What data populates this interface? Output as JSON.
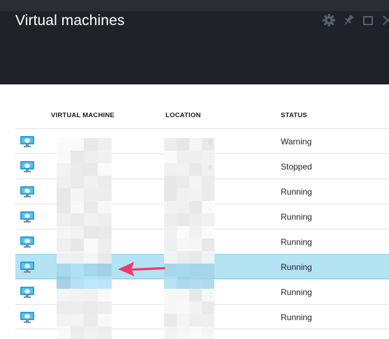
{
  "blade": {
    "title": "Virtual machines",
    "actions": [
      {
        "icon": "gear-icon"
      },
      {
        "icon": "pin-icon"
      },
      {
        "icon": "maximize-icon"
      },
      {
        "icon": "close-icon"
      }
    ]
  },
  "grid": {
    "columns": [
      "VIRTUAL MACHINE",
      "LOCATION",
      "STATUS"
    ],
    "rows": [
      {
        "icon": "virtual-machine-icon",
        "location_tail": "e",
        "status": "Warning",
        "selected": false
      },
      {
        "icon": "virtual-machine-icon",
        "location_tail": "e",
        "status": "Stopped",
        "selected": false
      },
      {
        "icon": "virtual-machine-icon",
        "location_tail": "",
        "status": "Running",
        "selected": false
      },
      {
        "icon": "virtual-machine-icon",
        "location_tail": "",
        "status": "Running",
        "selected": false
      },
      {
        "icon": "virtual-machine-icon",
        "location_tail": "",
        "status": "Running",
        "selected": false
      },
      {
        "icon": "virtual-machine-icon",
        "location_tail": "",
        "status": "Running",
        "selected": true
      },
      {
        "icon": "virtual-machine-icon",
        "location_tail": "",
        "status": "Running",
        "selected": false
      },
      {
        "icon": "virtual-machine-icon",
        "location_tail": "",
        "status": "Running",
        "selected": false
      }
    ]
  },
  "colors": {
    "header_bg": "#1f2327",
    "selected_row": "#b4e3f4",
    "annotation_arrow": "#f0386b",
    "vm_icon_blue": "#2a9fd8"
  },
  "annotation": {
    "icon": "arrow-left-icon"
  }
}
